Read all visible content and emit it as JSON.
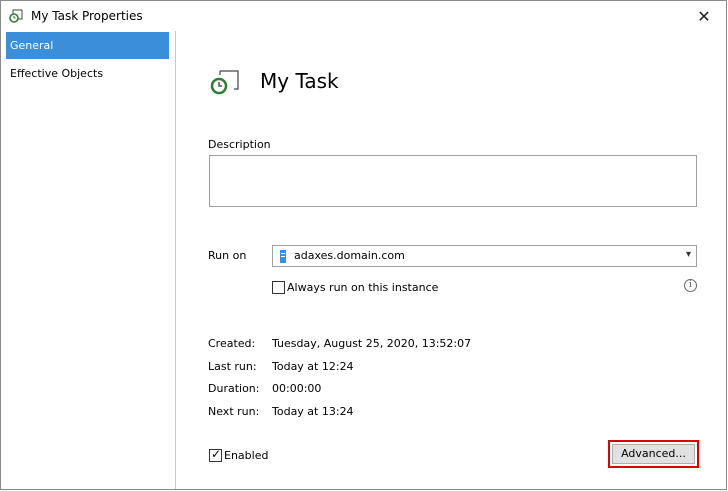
{
  "window": {
    "title": "My Task Properties",
    "close_glyph": "✕"
  },
  "sidebar": {
    "items": [
      {
        "label": "General",
        "selected": true
      },
      {
        "label": "Effective Objects",
        "selected": false
      }
    ]
  },
  "main": {
    "task_name": "My Task",
    "description": {
      "label": "Description",
      "value": ""
    },
    "run_on": {
      "label": "Run on",
      "value": "adaxes.domain.com",
      "icon": "server-icon"
    },
    "always_run": {
      "label": "Always run on this instance",
      "checked": false
    },
    "info_glyph": "i",
    "details": [
      {
        "label": "Created:",
        "value": "Tuesday, August 25, 2020, 13:52:07"
      },
      {
        "label": "Last run:",
        "value": "Today at 12:24"
      },
      {
        "label": "Duration:",
        "value": "00:00:00"
      },
      {
        "label": "Next run:",
        "value": "Today at 13:24"
      }
    ],
    "enabled": {
      "label": "Enabled",
      "checked": true
    },
    "advanced_label": "Advanced..."
  },
  "colors": {
    "selected": "#3b8ed9",
    "highlight": "#e00000",
    "icon_green": "#2e7d32"
  }
}
